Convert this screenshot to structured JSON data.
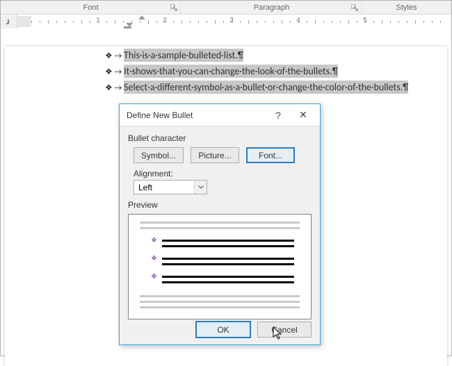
{
  "ribbon": {
    "groups": [
      "Font",
      "Paragraph",
      "Styles"
    ]
  },
  "ruler": {
    "numbers": [
      "1",
      "2",
      "3",
      "4",
      "5"
    ]
  },
  "document": {
    "items": [
      "This·is·a·sample·bulleted·list.¶",
      "It·shows·that·you·can·change·the·look·of·the·bullets.¶",
      "Select·a·different·symbol·as·a·bullet·or·change·the·color·of·the·bullets.¶"
    ]
  },
  "dialog": {
    "title": "Define New Bullet",
    "help": "?",
    "close": "✕",
    "group_bullet_char": "Bullet character",
    "symbol_btn": "Symbol...",
    "picture_btn": "Picture...",
    "font_btn": "Font...",
    "alignment_label": "Alignment:",
    "alignment_value": "Left",
    "preview_label": "Preview",
    "ok": "OK",
    "cancel": "Cancel"
  }
}
